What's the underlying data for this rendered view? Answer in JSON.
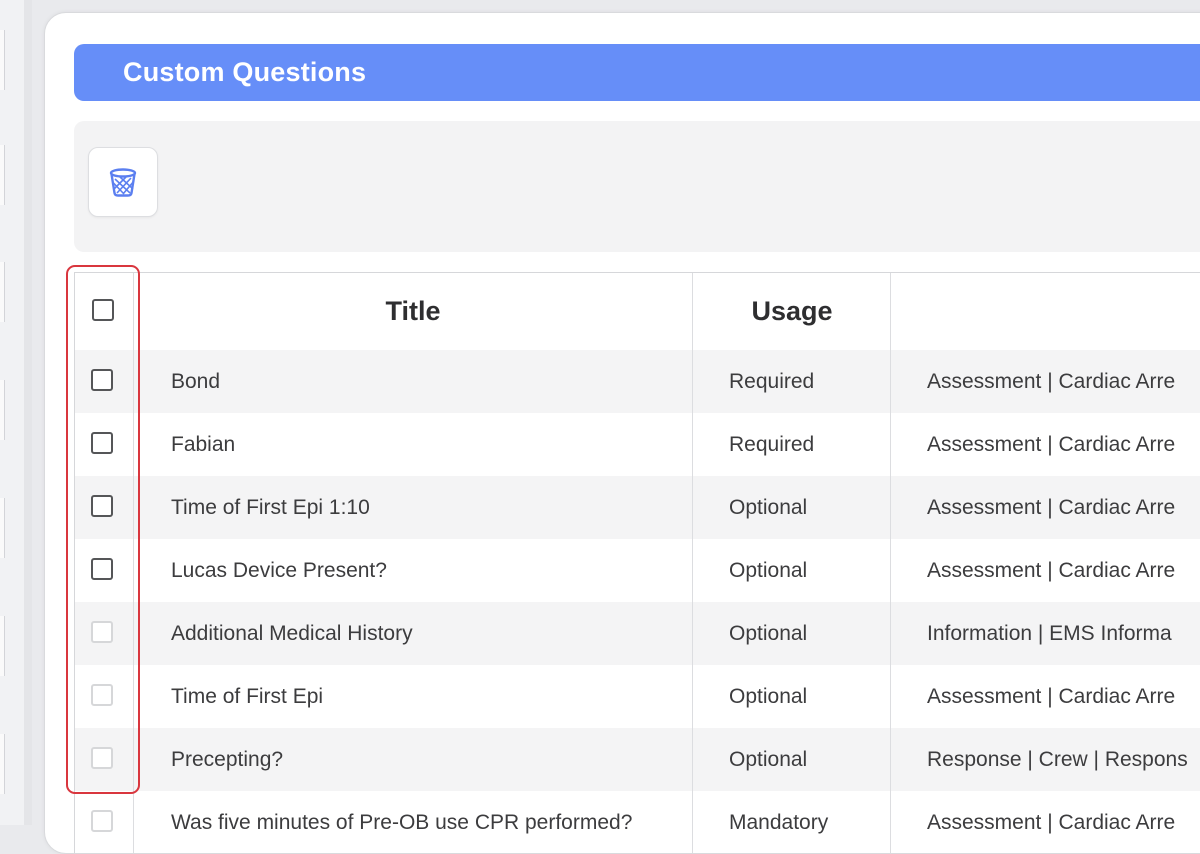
{
  "panel": {
    "title": "Custom Questions"
  },
  "toolbar": {
    "delete_icon": "trash-can-icon"
  },
  "table": {
    "columns": {
      "title": "Title",
      "usage": "Usage",
      "category": ""
    },
    "rows": [
      {
        "title": "Bond",
        "usage": "Required",
        "category": "Assessment | Cardiac Arre",
        "checkbox_enabled": true
      },
      {
        "title": "Fabian",
        "usage": "Required",
        "category": "Assessment | Cardiac Arre",
        "checkbox_enabled": true
      },
      {
        "title": "Time of First Epi 1:10",
        "usage": "Optional",
        "category": "Assessment | Cardiac Arre",
        "checkbox_enabled": true
      },
      {
        "title": "Lucas Device Present?",
        "usage": "Optional",
        "category": "Assessment | Cardiac Arre",
        "checkbox_enabled": true
      },
      {
        "title": "Additional Medical History",
        "usage": "Optional",
        "category": "Information | EMS Informa",
        "checkbox_enabled": false
      },
      {
        "title": "Time of First Epi",
        "usage": "Optional",
        "category": "Assessment | Cardiac Arre",
        "checkbox_enabled": false
      },
      {
        "title": "Precepting?",
        "usage": "Optional",
        "category": "Response | Crew | Respons",
        "checkbox_enabled": false
      },
      {
        "title": "Was five minutes of Pre-OB use CPR performed?",
        "usage": "Mandatory",
        "category": "Assessment | Cardiac Arre",
        "checkbox_enabled": false
      }
    ]
  },
  "colors": {
    "header": "#668ef8",
    "highlight": "#d9363e",
    "icon": "#5b7ff0"
  }
}
